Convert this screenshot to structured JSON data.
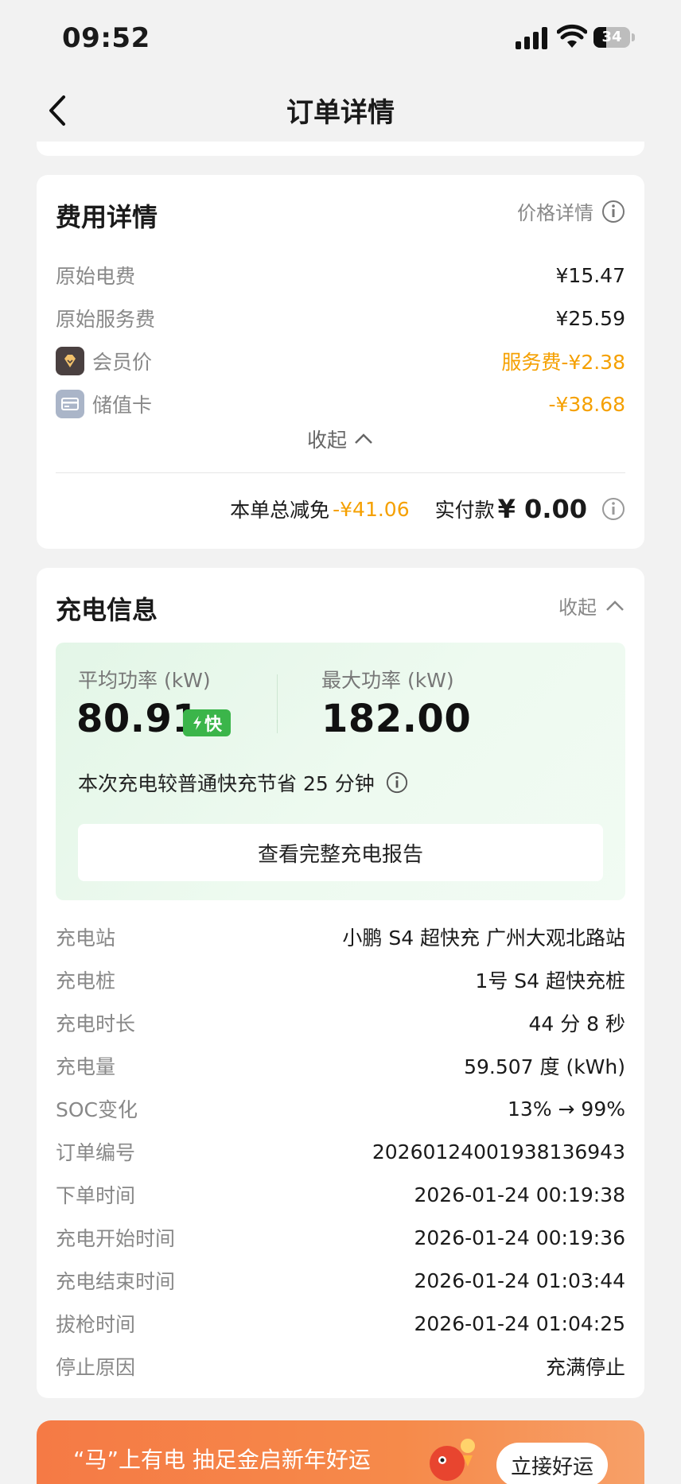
{
  "status_bar": {
    "time": "09:52",
    "battery": "34",
    "battery_level": 0.34
  },
  "nav": {
    "title": "订单详情"
  },
  "fee_card": {
    "title": "费用详情",
    "price_detail_link": "价格详情",
    "rows": [
      {
        "label": "原始电费",
        "value": "¥15.47"
      },
      {
        "label": "原始服务费",
        "value": "¥25.59"
      },
      {
        "label": "会员价",
        "value": "服务费-¥2.38",
        "icon": "diamond-icon"
      },
      {
        "label": "储值卡",
        "value": "-¥38.68",
        "icon": "card-icon"
      }
    ],
    "collapse_label": "收起",
    "total_discount_label": "本单总减免",
    "total_discount_value": "-¥41.06",
    "paid_label": "实付款",
    "paid_value": "¥ 0.00"
  },
  "charge_card": {
    "title": "充电信息",
    "collapse_label": "收起",
    "avg_power_label": "平均功率 (kW)",
    "avg_power_value": "80.91",
    "fast_badge": "快",
    "max_power_label": "最大功率 (kW)",
    "max_power_value": "182.00",
    "save_note": "本次充电较普通快充节省 25 分钟",
    "report_button": "查看完整充电报告",
    "rows": [
      {
        "label": "充电站",
        "value": "小鹏 S4 超快充 广州大观北路站"
      },
      {
        "label": "充电桩",
        "value": "1号 S4 超快充桩"
      },
      {
        "label": "充电时长",
        "value": "44 分 8 秒"
      },
      {
        "label": "充电量",
        "value": "59.507 度 (kWh)"
      },
      {
        "label": "SOC变化",
        "value": "13% → 99%"
      },
      {
        "label": "订单编号",
        "value": "20260124001938136943"
      },
      {
        "label": "下单时间",
        "value": "2026-01-24 00:19:38"
      },
      {
        "label": "充电开始时间",
        "value": "2026-01-24 00:19:36"
      },
      {
        "label": "充电结束时间",
        "value": "2026-01-24 01:03:44"
      },
      {
        "label": "拔枪时间",
        "value": "2026-01-24 01:04:25"
      },
      {
        "label": "停止原因",
        "value": "充满停止"
      }
    ]
  },
  "banner": {
    "text": "“马”上有电 抽足金启新年好运",
    "button": "立接好运"
  },
  "colors": {
    "accent_orange": "#f5a000",
    "fast_green": "#3bb54a",
    "banner_orange": "#f57a45"
  }
}
